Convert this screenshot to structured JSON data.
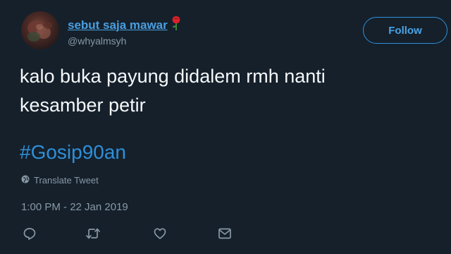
{
  "author": {
    "display_name": "sebut saja mawar",
    "handle": "@whyalmsyh",
    "badge_icon": "rose-icon"
  },
  "follow_button": {
    "label": "Follow"
  },
  "tweet": {
    "text": "kalo buka payung didalem rmh nanti\nkesamber petir",
    "hashtag": "#Gosip90an",
    "translate_label": "Translate Tweet",
    "timestamp": "1:00 PM - 22 Jan 2019"
  },
  "actions": [
    {
      "icon": "reply-icon"
    },
    {
      "icon": "retweet-icon"
    },
    {
      "icon": "like-icon"
    },
    {
      "icon": "message-icon"
    }
  ],
  "colors": {
    "background": "#15202b",
    "accent": "#2f8fd8",
    "secondary_text": "#8899a6"
  }
}
